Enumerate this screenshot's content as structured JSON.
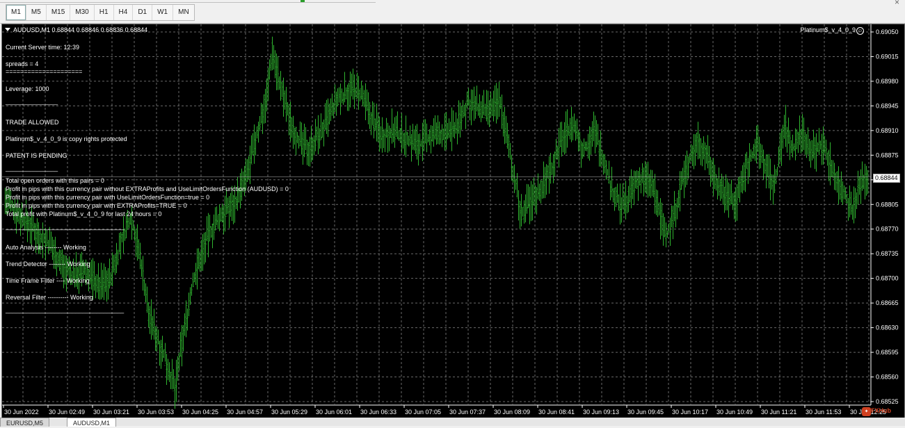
{
  "timeframes": [
    "M1",
    "M5",
    "M15",
    "M30",
    "H1",
    "H4",
    "D1",
    "W1",
    "MN"
  ],
  "active_timeframe": "M1",
  "chart": {
    "symbol_label": "AUDUSD,M1  0.68844 0.68846 0.68836 0.68844",
    "ea_name": "Platinum$_v_4_0_9",
    "smile_icon": "☺",
    "current_price": "0.68844",
    "price_ticks": [
      "0.69050",
      "0.69015",
      "0.68980",
      "0.68945",
      "0.68910",
      "0.68875",
      "0.68840",
      "0.68805",
      "0.68770",
      "0.68735",
      "0.68700",
      "0.68665",
      "0.68630",
      "0.68595",
      "0.68560",
      "0.68525"
    ],
    "time_ticks": [
      "30 Jun 2022",
      "30 Jun 02:49",
      "30 Jun 03:21",
      "30 Jun 03:53",
      "30 Jun 04:25",
      "30 Jun 04:57",
      "30 Jun 05:29",
      "30 Jun 06:01",
      "30 Jun 06:33",
      "30 Jun 07:05",
      "30 Jun 07:37",
      "30 Jun 08:09",
      "30 Jun 08:41",
      "30 Jun 09:13",
      "30 Jun 09:45",
      "30 Jun 10:17",
      "30 Jun 10:49",
      "30 Jun 11:21",
      "30 Jun 11:53",
      "30 Jun 12:25"
    ],
    "colors": {
      "background": "#000000",
      "bars": "#2fb52f",
      "grid": "#6a6a6a",
      "text": "#ffffff"
    }
  },
  "info_panel": {
    "server_time": "Current Server time: 12:39",
    "spreads": " spreads = 4",
    "separator1": "=====================",
    "leverage": "Leverage: 1000",
    "line1": "_______________",
    "trade": "TRADE ALLOWED",
    "protected": "Platinum$_v_4_0_9 is copy rights protected",
    "patent": "PATENT IS PENDING",
    "line2": "_______________",
    "open_orders": "Total open orders with this pairs = 0",
    "profit1": "Profit in pips with this currency pair without EXTRAProfits and UseLimitOrdersFunction (AUDUSD) = 0",
    "profit2": "Profit in pips with this currency pair with UseLimitOrdersFunction=true  = 0",
    "profit3": "Profit in pips with this currency pair with EXTRAProfits=TRUE  = 0",
    "total_profit": "Total profit with Platinum$_v_4_0_9 for last 24 hours = 0",
    "line3": "__________________________________",
    "auto_analysis": "Auto Analysis  -------- Working",
    "trend_detector": "Trend Detector  -------- Working",
    "tf_filter": "Time Frame Filter ---- Working",
    "reversal_filter": "Reversal Filter ---------- Working",
    "line4": "__________________________________"
  },
  "bottom_tabs": [
    "EURUSD,M5",
    "AUDUSD,M1"
  ],
  "active_tab": "AUDUSD,M1",
  "watermark": "FXHub"
}
